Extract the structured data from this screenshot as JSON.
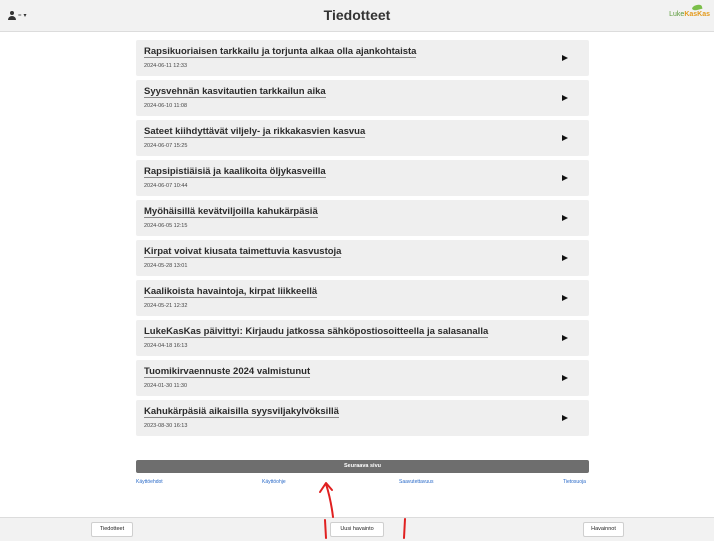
{
  "header": {
    "title": "Tiedotteet",
    "user_menu_icon": "user-icon",
    "user_menu_text": "=",
    "caret": "▾",
    "logo_luke": "Luke",
    "logo_kaskas": "KasKas"
  },
  "bulletins": [
    {
      "title": "Rapsikuoriaisen tarkkailu ja torjunta alkaa olla ajankohtaista",
      "date": "2024-06-11 12:33"
    },
    {
      "title": "Syysvehnän kasvitautien tarkkailun aika",
      "date": "2024-06-10 11:08"
    },
    {
      "title": "Sateet kiihdyttävät viljely- ja rikkakasvien kasvua",
      "date": "2024-06-07 15:25"
    },
    {
      "title": "Rapsipistiäisiä ja kaalikoita öljykasveilla",
      "date": "2024-06-07 10:44"
    },
    {
      "title": "Myöhäisillä kevätviljoilla kahukärpäsiä",
      "date": "2024-06-05 12:15"
    },
    {
      "title": "Kirpat voivat kiusata taimettuvia kasvustoja",
      "date": "2024-05-28 13:01"
    },
    {
      "title": "Kaalikoista havaintoja, kirpat liikkeellä",
      "date": "2024-05-21 12:32"
    },
    {
      "title": "LukeKasKas päivittyi: Kirjaudu jatkossa sähköpostiosoitteella ja salasanalla",
      "date": "2024-04-18 16:13"
    },
    {
      "title": "Tuomikirvaennuste 2024 valmistunut",
      "date": "2024-01-30 11:30"
    },
    {
      "title": "Kahukärpäsiä aikaisilla syysviljakylvöksillä",
      "date": "2023-08-30 16:13"
    }
  ],
  "pagination": {
    "next_label": "Seuraava sivu"
  },
  "footer_links": {
    "terms": "Käyttöehdot",
    "manual": "Käyttöohje",
    "accessibility": "Saavutettavuus",
    "privacy": "Tietosuoja"
  },
  "bottom_nav": {
    "bulletins": "Tiedotteet",
    "new_observation": "Uusi havainto",
    "observations": "Havainnot"
  },
  "colors": {
    "accent_link": "#2a6ac8",
    "annotation": "#e02020",
    "logo_green": "#5a9a3a",
    "logo_orange": "#e39a1c"
  }
}
